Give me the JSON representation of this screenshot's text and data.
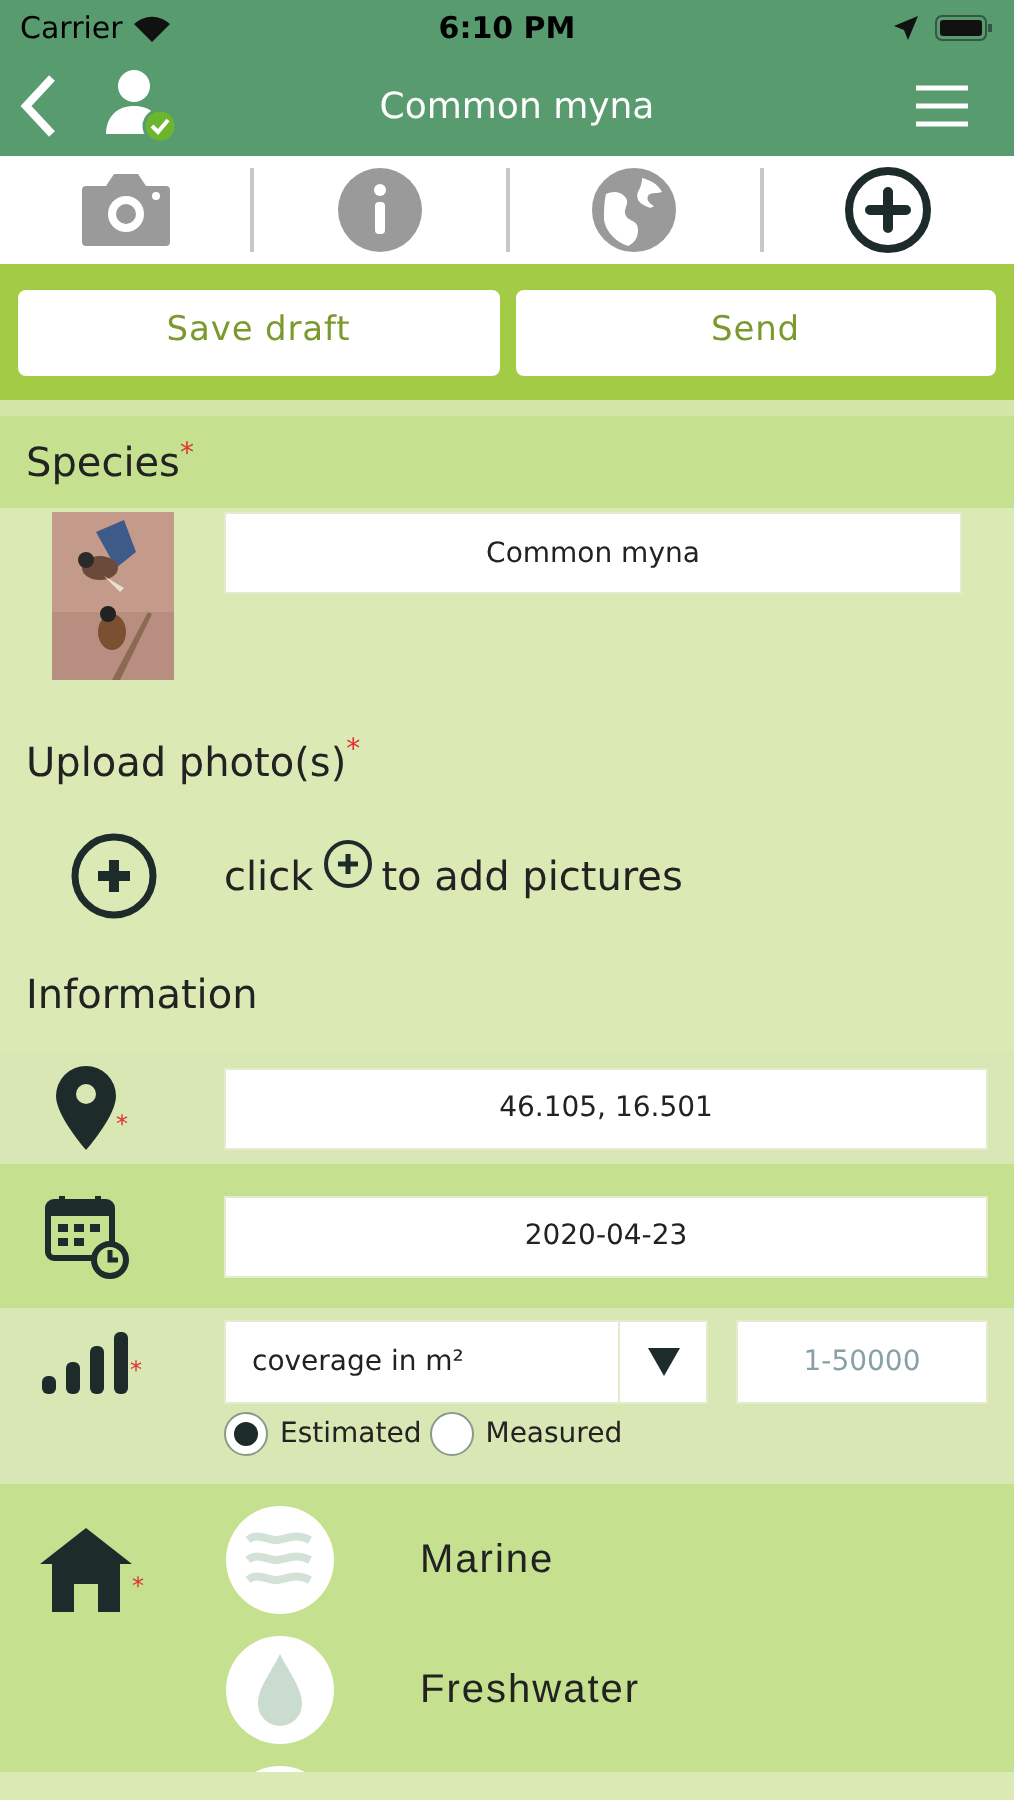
{
  "status_bar": {
    "carrier": "Carrier",
    "time": "6:10 PM"
  },
  "nav": {
    "title": "Common myna"
  },
  "tabs": [
    {
      "kind": "camera",
      "selected": false
    },
    {
      "kind": "info",
      "selected": false
    },
    {
      "kind": "globe",
      "selected": false
    },
    {
      "kind": "plus",
      "selected": true
    }
  ],
  "buttons": [
    "Save draft",
    "Send"
  ],
  "species": {
    "label": "Species",
    "mark": "*",
    "value": "Common myna"
  },
  "upload": {
    "label": "Upload photo(s)",
    "mark": "*",
    "hint_before": "click",
    "hint_after": "to add pictures"
  },
  "information": {
    "label": "Information",
    "location": {
      "mark": "*",
      "value": "46.105, 16.501"
    },
    "date": {
      "value": "2020-04-23"
    },
    "abundance": {
      "mark": "*",
      "unit": "coverage in m²",
      "placeholder": "1-50000",
      "options": [
        {
          "label": "Estimated",
          "selected": true
        },
        {
          "label": "Measured",
          "selected": false
        }
      ]
    },
    "habitat": {
      "mark": "*",
      "items": [
        {
          "kind": "waves",
          "label": "Marine"
        },
        {
          "kind": "drop",
          "label": "Freshwater"
        },
        {
          "kind": "blank"
        }
      ]
    }
  }
}
